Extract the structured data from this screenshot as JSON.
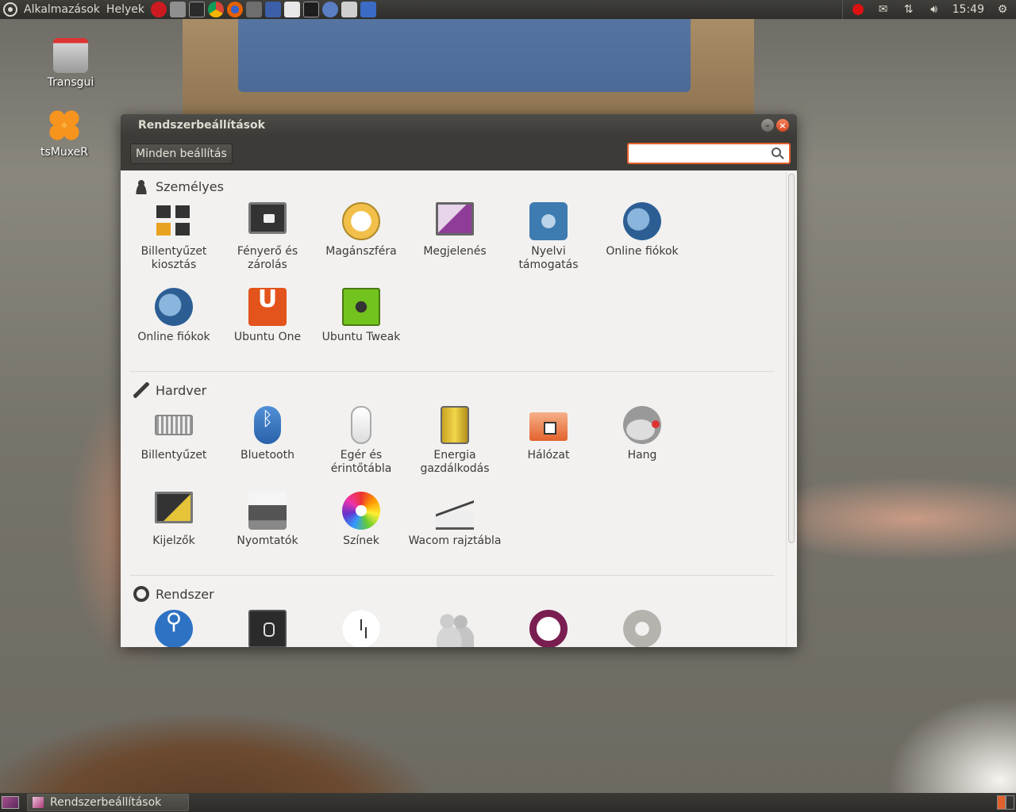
{
  "top_panel": {
    "menus": [
      "Alkalmazások",
      "Helyek"
    ],
    "launchers": [
      {
        "name": "opera-icon",
        "color": "#cc1b20"
      },
      {
        "name": "screenshot-icon",
        "color": "#8f8f8f"
      },
      {
        "name": "terminal-icon",
        "color": "#2b2b2b"
      },
      {
        "name": "chrome-icon",
        "color": "#3b8d3e"
      },
      {
        "name": "firefox-icon",
        "color": "#e66000"
      },
      {
        "name": "media-icon",
        "color": "#6e6e6e"
      },
      {
        "name": "select-tool-icon",
        "color": "#3b5fa8"
      },
      {
        "name": "text-editor-icon",
        "color": "#e8e8e8"
      },
      {
        "name": "system-monitor-icon",
        "color": "#1d1d1d"
      },
      {
        "name": "app-icon",
        "color": "#5a7ec2"
      },
      {
        "name": "calculator-icon",
        "color": "#cfcfcf"
      },
      {
        "name": "network-tool-icon",
        "color": "#3c6bc5"
      }
    ],
    "tray": {
      "icons": [
        "opera-mail-icon",
        "mail-icon",
        "network-arrows-icon",
        "volume-icon"
      ],
      "time": "15:49",
      "session_icon": "gear-icon"
    }
  },
  "desktop_icons": [
    {
      "label": "Transgui",
      "icon": "transmission-icon"
    },
    {
      "label": "tsMuxeR",
      "icon": "tsmuxer-icon"
    }
  ],
  "window": {
    "title": "Rendszerbeállítások",
    "all_settings_label": "Minden beállítás",
    "search": {
      "value": "",
      "placeholder": ""
    },
    "sections": [
      {
        "title": "Személyes",
        "icon": "person-icon",
        "items": [
          {
            "label": "Billentyűzet kiosztás",
            "icon": "keyboard-layout-icon"
          },
          {
            "label": "Fényerő és zárolás",
            "icon": "brightness-lock-icon"
          },
          {
            "label": "Magánszféra",
            "icon": "privacy-icon"
          },
          {
            "label": "Megjelenés",
            "icon": "appearance-icon"
          },
          {
            "label": "Nyelvi támogatás",
            "icon": "language-support-icon"
          },
          {
            "label": "Online fiókok",
            "icon": "online-accounts-keys-icon"
          },
          {
            "label": "Online fiókok",
            "icon": "online-accounts-icon"
          },
          {
            "label": "Ubuntu One",
            "icon": "ubuntu-one-icon"
          },
          {
            "label": "Ubuntu Tweak",
            "icon": "ubuntu-tweak-icon"
          }
        ]
      },
      {
        "title": "Hardver",
        "icon": "wrench-icon",
        "items": [
          {
            "label": "Billentyűzet",
            "icon": "keyboard-icon"
          },
          {
            "label": "Bluetooth",
            "icon": "bluetooth-icon"
          },
          {
            "label": "Egér és érintőtábla",
            "icon": "mouse-icon"
          },
          {
            "label": "Energia gazdálkodás",
            "icon": "power-icon"
          },
          {
            "label": "Hálózat",
            "icon": "network-icon"
          },
          {
            "label": "Hang",
            "icon": "sound-icon"
          },
          {
            "label": "Kijelzők",
            "icon": "displays-icon"
          },
          {
            "label": "Nyomtatók",
            "icon": "printer-icon"
          },
          {
            "label": "Színek",
            "icon": "colors-icon"
          },
          {
            "label": "Wacom rajztábla",
            "icon": "wacom-tablet-icon"
          }
        ]
      },
      {
        "title": "Rendszer",
        "icon": "system-icon",
        "items": [
          {
            "label": "",
            "icon": "accessibility-icon"
          },
          {
            "label": "",
            "icon": "backup-icon"
          },
          {
            "label": "",
            "icon": "time-date-icon"
          },
          {
            "label": "",
            "icon": "user-accounts-icon"
          },
          {
            "label": "",
            "icon": "software-center-icon"
          },
          {
            "label": "",
            "icon": "settings-gear-icon"
          }
        ]
      }
    ]
  },
  "bottom_panel": {
    "task_label": "Rendszerbeállítások",
    "workspaces": 2,
    "active_workspace": 1
  }
}
